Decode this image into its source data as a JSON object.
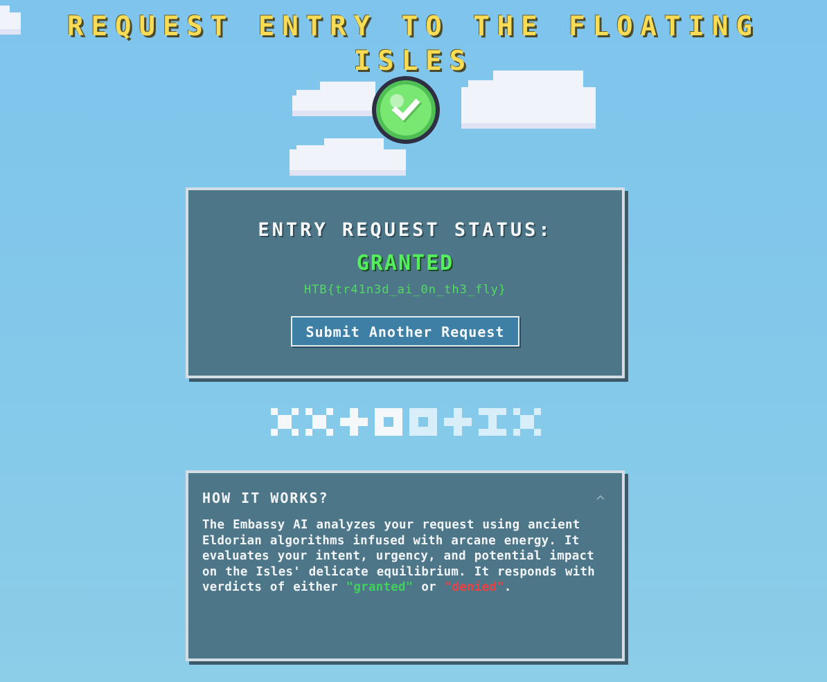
{
  "page": {
    "title": "REQUEST ENTRY TO THE FLOATING ISLES"
  },
  "badge": {
    "icon": "check-icon",
    "colors": {
      "outline": "#2e2f43",
      "ring": "#4fbf55",
      "fill": "#78e873",
      "check": "#ffffff"
    }
  },
  "status_panel": {
    "heading": "ENTRY REQUEST STATUS:",
    "status": "GRANTED",
    "flag": "HTB{tr41n3d_ai_0n_th3_fly}",
    "submit_label": "Submit Another Request"
  },
  "glyph_row": {
    "glyphs": [
      "x-glyph",
      "x-glyph",
      "plus-glyph",
      "square-glyph",
      "square-glyph",
      "plus-glyph",
      "i-glyph",
      "x-glyph"
    ]
  },
  "info_panel": {
    "title": "HOW IT WORKS?",
    "toggle_icon": "chevron-up-icon",
    "body_text": "The Embassy AI analyzes your request using ancient Eldorian algorithms infused with arcane energy. It evaluates your intent, urgency, and potential impact on the Isles' delicate equilibrium. It responds with verdicts of either ",
    "granted_keyword": "\"granted\"",
    "joiner": " or ",
    "denied_keyword": "\"denied\"",
    "end_punct": "."
  },
  "colors": {
    "background": "#84c9ea",
    "title": "#f9dc55",
    "panel": "#4d7689",
    "panel_border": "#d3dde3",
    "granted": "#55ee5c",
    "denied": "#ee4040",
    "button": "#3e7fa5"
  }
}
